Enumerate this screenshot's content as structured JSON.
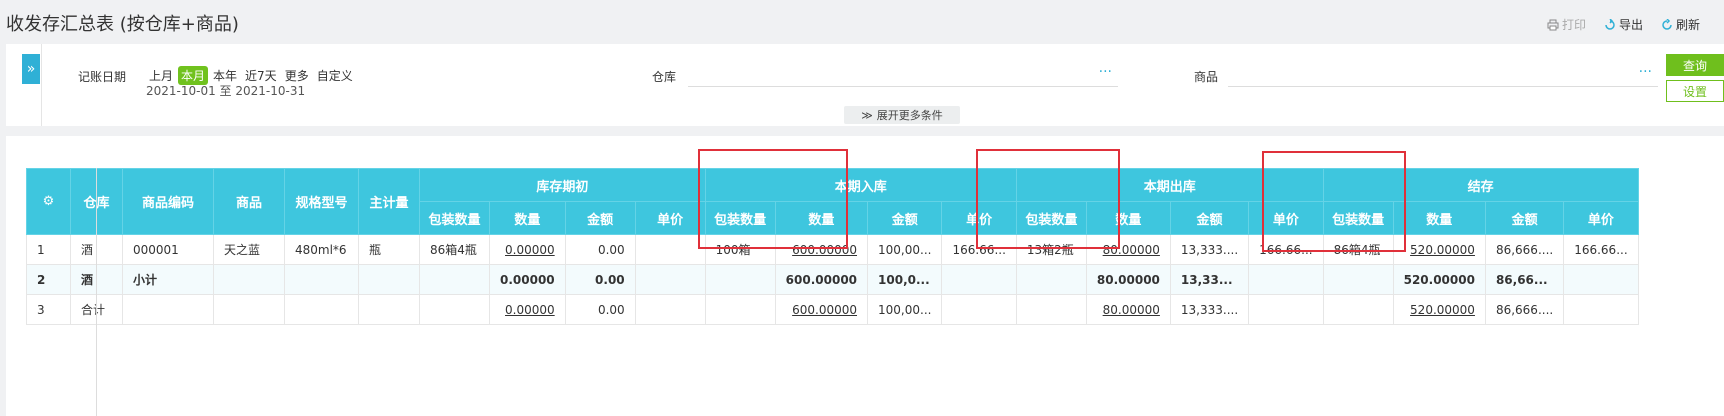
{
  "page": {
    "title": "收发存汇总表 (按仓库+商品)"
  },
  "toolbar": {
    "print": "打印",
    "export": "导出",
    "refresh": "刷新"
  },
  "filter": {
    "date_label": "记账日期",
    "date_options": [
      "上月",
      "本月",
      "本年",
      "近7天",
      "更多",
      "自定义"
    ],
    "active_option": "本月",
    "date_range": "2021-10-01 至 2021-10-31",
    "warehouse_label": "仓库",
    "warehouse_dots": "···",
    "product_label": "商品",
    "product_dots": "···",
    "more_conditions": "展开更多条件",
    "query": "查询",
    "settings": "设置"
  },
  "table": {
    "fixed_headers": [
      "仓库",
      "商品编码",
      "商品",
      "规格型号",
      "主计量"
    ],
    "groups": [
      "库存期初",
      "本期入库",
      "本期出库",
      "结存"
    ],
    "sub_headers": [
      "包装数量",
      "数量",
      "金额",
      "单价"
    ],
    "rows": [
      {
        "no": "1",
        "warehouse": "酒",
        "code": "000001",
        "product": "天之蓝",
        "spec": "480ml*6",
        "unit": "瓶",
        "values": [
          "86箱4瓶",
          "0.00000",
          "0.00",
          "",
          "100箱",
          "600.00000",
          "100,00...",
          "166.66...",
          "13箱2瓶",
          "80.00000",
          "13,333....",
          "166.66...",
          "86箱4瓶",
          "520.00000",
          "86,666....",
          "166.66..."
        ]
      },
      {
        "no": "2",
        "warehouse": "酒",
        "code": "小计",
        "product": "",
        "spec": "",
        "unit": "",
        "values": [
          "",
          "0.00000",
          "0.00",
          "",
          "",
          "600.00000",
          "100,0...",
          "",
          "",
          "80.00000",
          "13,33...",
          "",
          "",
          "520.00000",
          "86,66...",
          ""
        ]
      },
      {
        "no": "3",
        "warehouse": "合计",
        "code": "",
        "product": "",
        "spec": "",
        "unit": "",
        "values": [
          "",
          "0.00000",
          "0.00",
          "",
          "",
          "600.00000",
          "100,00...",
          "",
          "",
          "80.00000",
          "13,333....",
          "",
          "",
          "520.00000",
          "86,666....",
          ""
        ]
      }
    ]
  }
}
